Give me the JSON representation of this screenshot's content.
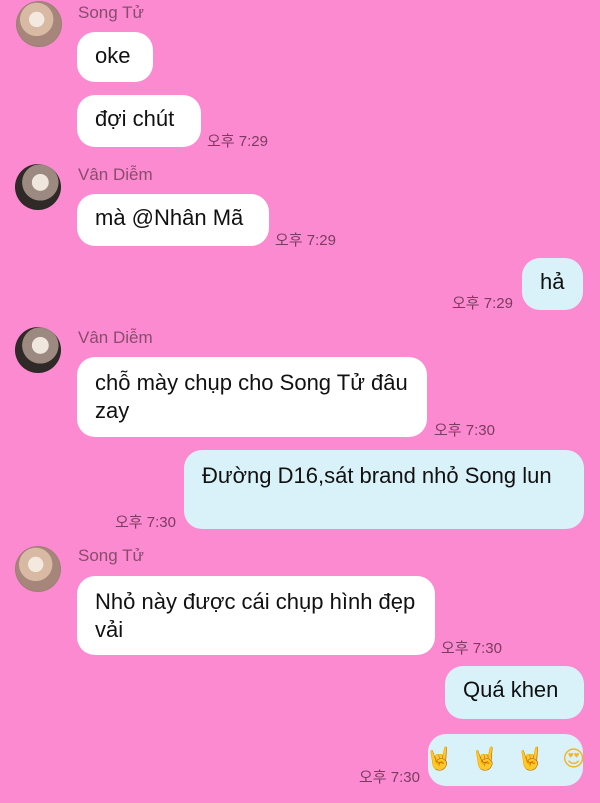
{
  "messages": {
    "song_tu_1": {
      "sender": "Song Tử",
      "lines": [
        "oke",
        "đợi chút"
      ],
      "time": "오후 7:29"
    },
    "van_diem_1": {
      "sender": "Vân Diễm",
      "text": "mà @Nhân Mã",
      "time": "오후 7:29"
    },
    "me_1": {
      "text": "hả",
      "time": "오후 7:29"
    },
    "van_diem_2": {
      "sender": "Vân Diễm",
      "text": "chỗ mày chụp cho Song Tử đâu zay",
      "time": "오후 7:30"
    },
    "me_2": {
      "text": "Đường D16,sát brand nhỏ Song lun",
      "time": "오후 7:30"
    },
    "song_tu_2": {
      "sender": "Song Tử",
      "text": "Nhỏ này được cái chụp hình đẹp vải",
      "time": "오후 7:30"
    },
    "me_3": {
      "text": "Quá khen",
      "emojis": [
        "🤘",
        "🤘",
        "🤘",
        "😍"
      ],
      "time": "오후 7:30"
    }
  },
  "colors": {
    "background": "#fb8ad0",
    "incoming_bubble": "#ffffff",
    "outgoing_bubble": "#d9f2fa"
  }
}
